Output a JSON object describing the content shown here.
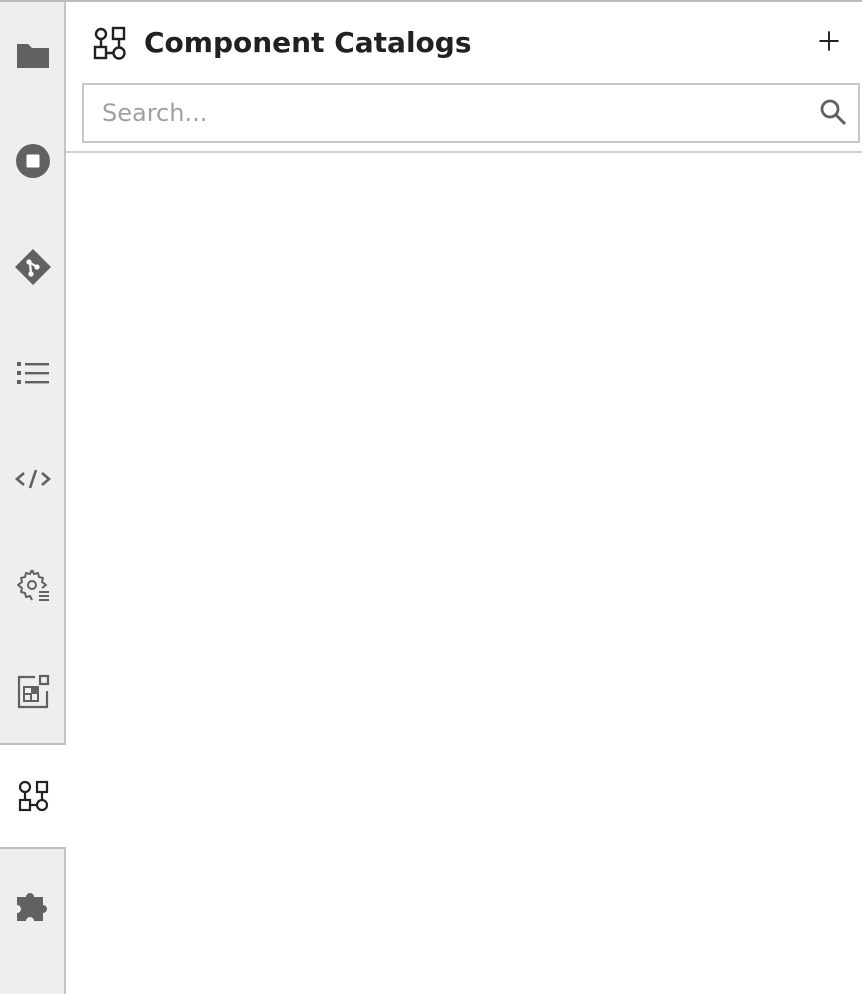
{
  "sidebar": {
    "items": [
      {
        "name": "file-browser",
        "icon": "folder-icon"
      },
      {
        "name": "running-sessions",
        "icon": "stop-circle-icon"
      },
      {
        "name": "git",
        "icon": "git-icon"
      },
      {
        "name": "table-of-contents",
        "icon": "list-icon"
      },
      {
        "name": "code-snippets",
        "icon": "code-icon"
      },
      {
        "name": "runtimes",
        "icon": "settings-list-icon"
      },
      {
        "name": "property-inspector",
        "icon": "inspector-icon"
      },
      {
        "name": "component-catalogs",
        "icon": "catalog-icon",
        "active": true
      },
      {
        "name": "extensions",
        "icon": "puzzle-icon"
      }
    ],
    "colors": {
      "icon": "#616161",
      "active_icon": "#212121",
      "background": "#eeeeee"
    }
  },
  "panel": {
    "title": "Component Catalogs",
    "add_icon": "plus-icon",
    "search": {
      "value": "",
      "placeholder": "Search...",
      "icon": "search-icon"
    }
  }
}
